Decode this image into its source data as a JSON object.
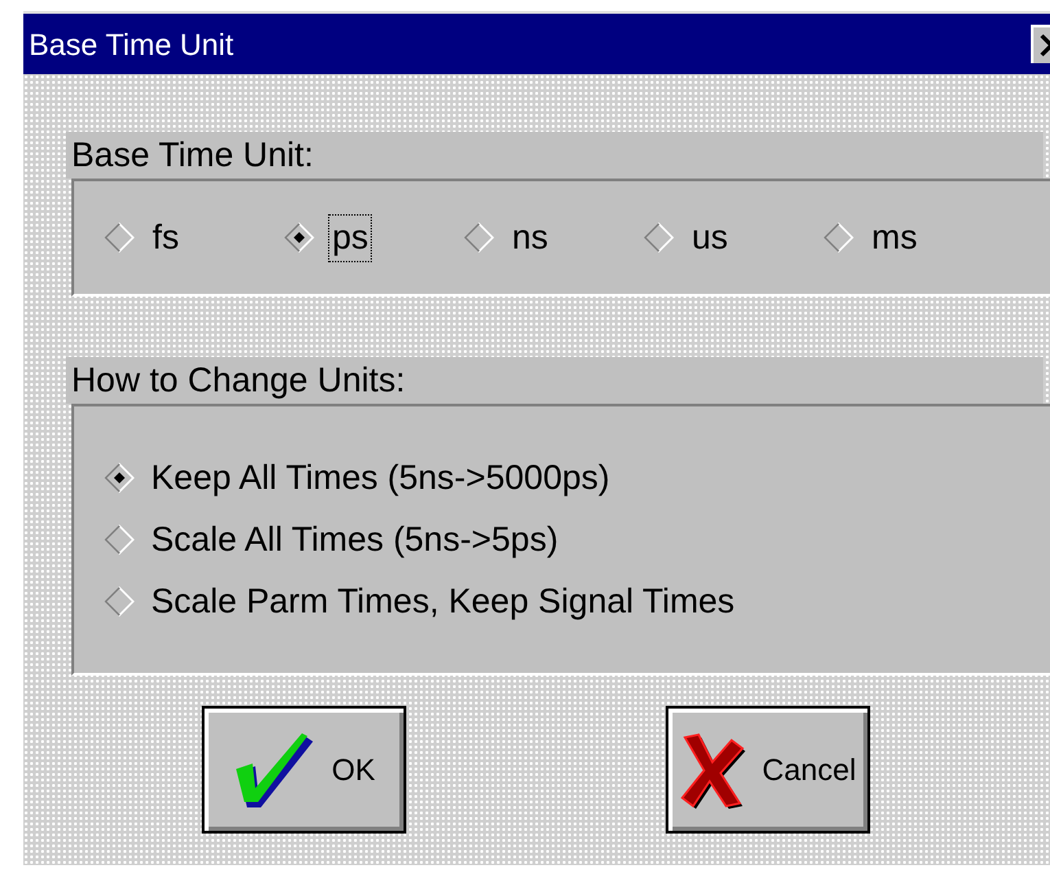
{
  "window": {
    "title": "Base Time Unit"
  },
  "base_unit": {
    "label": "Base Time Unit:",
    "options": [
      {
        "label": "fs",
        "selected": false
      },
      {
        "label": "ps",
        "selected": true
      },
      {
        "label": "ns",
        "selected": false
      },
      {
        "label": "us",
        "selected": false
      },
      {
        "label": "ms",
        "selected": false
      }
    ]
  },
  "change_units": {
    "label": "How to Change Units:",
    "options": [
      {
        "label": "Keep All Times (5ns->5000ps)",
        "selected": true
      },
      {
        "label": "Scale All Times (5ns->5ps)",
        "selected": false
      },
      {
        "label": "Scale Parm Times, Keep Signal Times",
        "selected": false
      }
    ]
  },
  "buttons": [
    {
      "kind": "ok",
      "label": "OK"
    },
    {
      "kind": "cancel",
      "label": "Cancel"
    }
  ]
}
